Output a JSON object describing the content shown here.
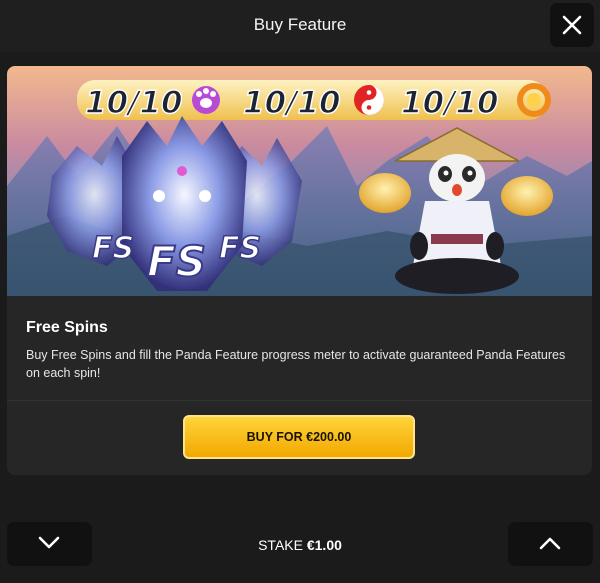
{
  "header": {
    "title": "Buy Feature",
    "close_icon": "close-icon"
  },
  "banner": {
    "counters": [
      {
        "text": "10/10",
        "icon": "paw-icon",
        "color": "#b84bd6"
      },
      {
        "text": "10/10",
        "icon": "yin-yang-icon",
        "color": "#e02424"
      },
      {
        "text": "10/10",
        "icon": "dragon-coin-icon",
        "color": "#f08a1a"
      }
    ],
    "fs_labels": [
      "FS",
      "FS",
      "FS"
    ]
  },
  "feature": {
    "title": "Free Spins",
    "description": "Buy Free Spins and fill the Panda Feature progress meter to activate guaranteed Panda Features on each spin!",
    "buy_label": "BUY FOR €200.00"
  },
  "footer": {
    "stake_label": "STAKE",
    "stake_value": "€1.00",
    "decrease_icon": "chevron-down-icon",
    "increase_icon": "chevron-up-icon"
  },
  "colors": {
    "background": "#1b1b1b",
    "card": "#262626",
    "button_gold": "#ffc21a",
    "button_dark": "#111111"
  }
}
